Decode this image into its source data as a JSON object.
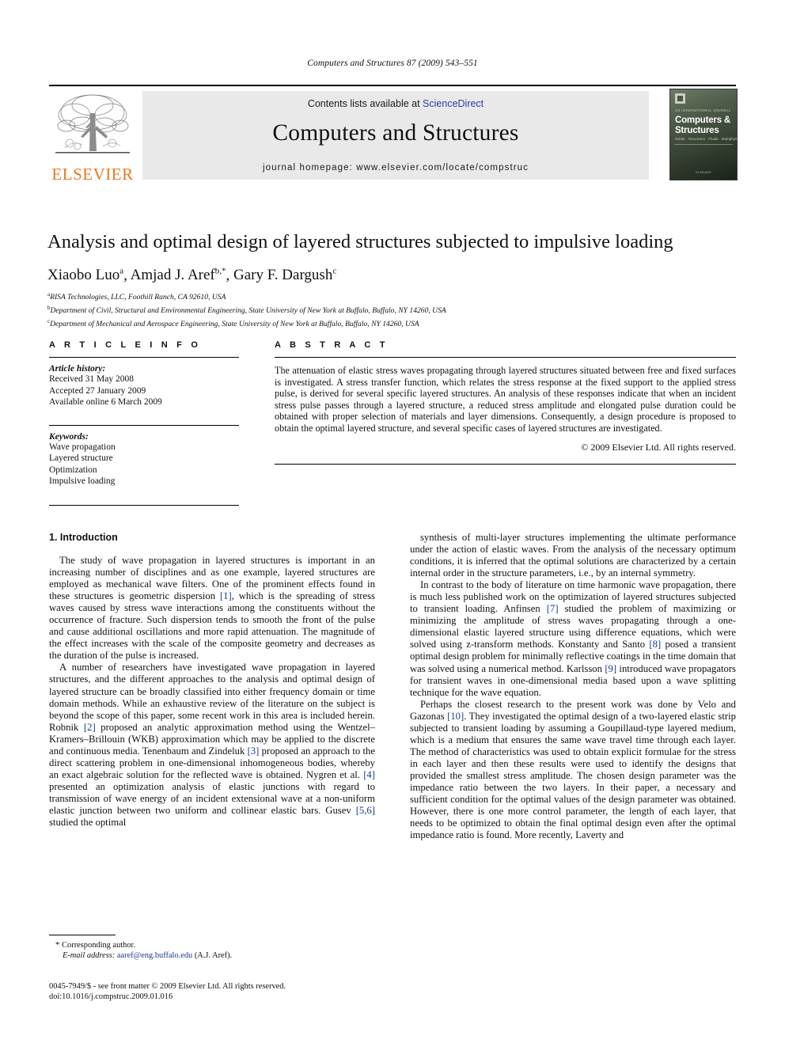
{
  "running_head": "Computers and Structures 87 (2009) 543–551",
  "masthead": {
    "publisher_logo_text": "ELSEVIER",
    "contents_prefix": "Contents lists available at ",
    "contents_link": "ScienceDirect",
    "journal_title": "Computers and Structures",
    "homepage_line": "journal homepage: www.elsevier.com/locate/compstruc",
    "cover": {
      "eyebrow": "AN INTERNATIONAL JOURNAL",
      "title": "Computers & Structures",
      "tagline": "Solids · Structures · Fluids · Multiphysics",
      "footer": "ELSEVIER"
    },
    "link_color": "#2b3f9e",
    "elsevier_orange": "#E87722"
  },
  "article": {
    "title": "Analysis and optimal design of layered structures subjected to impulsive loading",
    "authors": "Xiaobo Luo a, Amjad J. Aref b,*, Gary F. Dargush c",
    "author_parts": [
      {
        "name": "Xiaobo Luo",
        "sup": "a"
      },
      {
        "name": "Amjad J. Aref",
        "sup": "b,*"
      },
      {
        "name": "Gary F. Dargush",
        "sup": "c"
      }
    ],
    "affiliations": [
      {
        "sup": "a",
        "text": "RISA Technologies, LLC, Foothill Ranch, CA 92610, USA"
      },
      {
        "sup": "b",
        "text": "Department of Civil, Structural and Environmental Engineering, State University of New York at Buffalo, Buffalo, NY 14260, USA"
      },
      {
        "sup": "c",
        "text": "Department of Mechanical and Aerospace Engineering, State University of New York at Buffalo, Buffalo, NY 14260, USA"
      }
    ]
  },
  "article_info": {
    "heading": "A R T I C L E   I N F O",
    "history_label": "Article history:",
    "history": [
      "Received 31 May 2008",
      "Accepted 27 January 2009",
      "Available online 6 March 2009"
    ],
    "keywords_label": "Keywords:",
    "keywords": [
      "Wave propagation",
      "Layered structure",
      "Optimization",
      "Impulsive loading"
    ]
  },
  "abstract": {
    "heading": "A B S T R A C T",
    "text": "The attenuation of elastic stress waves propagating through layered structures situated between free and fixed surfaces is investigated. A stress transfer function, which relates the stress response at the fixed support to the applied stress pulse, is derived for several specific layered structures. An analysis of these responses indicate that when an incident stress pulse passes through a layered structure, a reduced stress amplitude and elongated pulse duration could be obtained with proper selection of materials and layer dimensions. Consequently, a design procedure is proposed to obtain the optimal layered structure, and several specific cases of layered structures are investigated.",
    "copyright": "© 2009 Elsevier Ltd. All rights reserved."
  },
  "body": {
    "section_heading": "1. Introduction",
    "left_paragraphs": [
      {
        "segments": [
          {
            "t": "The study of wave propagation in layered structures is important in an increasing number of disciplines and as one example, layered structures are employed as mechanical wave filters. One of the prominent effects found in these structures is geometric dispersion "
          },
          {
            "t": "[1]",
            "ref": true
          },
          {
            "t": ", which is the spreading of stress waves caused by stress wave interactions among the constituents without the occurrence of fracture. Such dispersion tends to smooth the front of the pulse and cause additional oscillations and more rapid attenuation. The magnitude of the effect increases with the scale of the composite geometry and decreases as the duration of the pulse is increased."
          }
        ]
      },
      {
        "segments": [
          {
            "t": "A number of researchers have investigated wave propagation in layered structures, and the different approaches to the analysis and optimal design of layered structure can be broadly classified into either frequency domain or time domain methods. While an exhaustive review of the literature on the subject is beyond the scope of this paper, some recent work in this area is included herein. Robnik "
          },
          {
            "t": "[2]",
            "ref": true
          },
          {
            "t": " proposed an analytic approximation method using the Wentzel–Kramers–Brillouin (WKB) approximation which may be applied to the discrete and continuous media. Tenenbaum and Zindeluk "
          },
          {
            "t": "[3]",
            "ref": true
          },
          {
            "t": " proposed an approach to the direct scattering problem in one-dimensional inhomogeneous bodies, whereby an exact algebraic solution for the reflected wave is obtained. Nygren et al. "
          },
          {
            "t": "[4]",
            "ref": true
          },
          {
            "t": " presented an optimization analysis of elastic junctions with regard to transmission of wave energy of an incident extensional wave at a non-uniform elastic junction between two uniform and collinear elastic bars. Gusev "
          },
          {
            "t": "[5,6]",
            "ref": true
          },
          {
            "t": " studied the optimal"
          }
        ]
      }
    ],
    "right_paragraphs": [
      {
        "segments": [
          {
            "t": "synthesis of multi-layer structures implementing the ultimate performance under the action of elastic waves. From the analysis of the necessary optimum conditions, it is inferred that the optimal solutions are characterized by a certain internal order in the structure parameters, i.e., by an internal symmetry."
          }
        ],
        "noindent_first": false
      },
      {
        "segments": [
          {
            "t": "In contrast to the body of literature on time harmonic wave propagation, there is much less published work on the optimization of layered structures subjected to transient loading. Anfinsen "
          },
          {
            "t": "[7]",
            "ref": true
          },
          {
            "t": " studied the problem of maximizing or minimizing the amplitude of stress waves propagating through a one-dimensional elastic layered structure using difference equations, which were solved using z-transform methods. Konstanty and Santo "
          },
          {
            "t": "[8]",
            "ref": true
          },
          {
            "t": " posed a transient optimal design problem for minimally reflective coatings in the time domain that was solved using a numerical method. Karlsson "
          },
          {
            "t": "[9]",
            "ref": true
          },
          {
            "t": " introduced wave propagators for transient waves in one-dimensional media based upon a wave splitting technique for the wave equation."
          }
        ]
      },
      {
        "segments": [
          {
            "t": "Perhaps the closest research to the present work was done by Velo and Gazonas "
          },
          {
            "t": "[10]",
            "ref": true
          },
          {
            "t": ". They investigated the optimal design of a two-layered elastic strip subjected to transient loading by assuming a Goupillaud-type layered medium, which is a medium that ensures the same wave travel time through each layer. The method of characteristics was used to obtain explicit formulae for the stress in each layer and then these results were used to identify the designs that provided the smallest stress amplitude. The chosen design parameter was the impedance ratio between the two layers. In their paper, a necessary and sufficient condition for the optimal values of the design parameter was obtained. However, there is one more control parameter, the length of each layer, that needs to be optimized to obtain the final optimal design even after the optimal impedance ratio is found. More recently, Laverty and"
          }
        ]
      }
    ]
  },
  "footnote": {
    "corresponding": "Corresponding author.",
    "email_label": "E-mail address:",
    "email": "aaref@eng.buffalo.edu",
    "email_owner": "(A.J. Aref)."
  },
  "issn_line1": "0045-7949/$ - see front matter © 2009 Elsevier Ltd. All rights reserved.",
  "issn_line2": "doi:10.1016/j.compstruc.2009.01.016"
}
